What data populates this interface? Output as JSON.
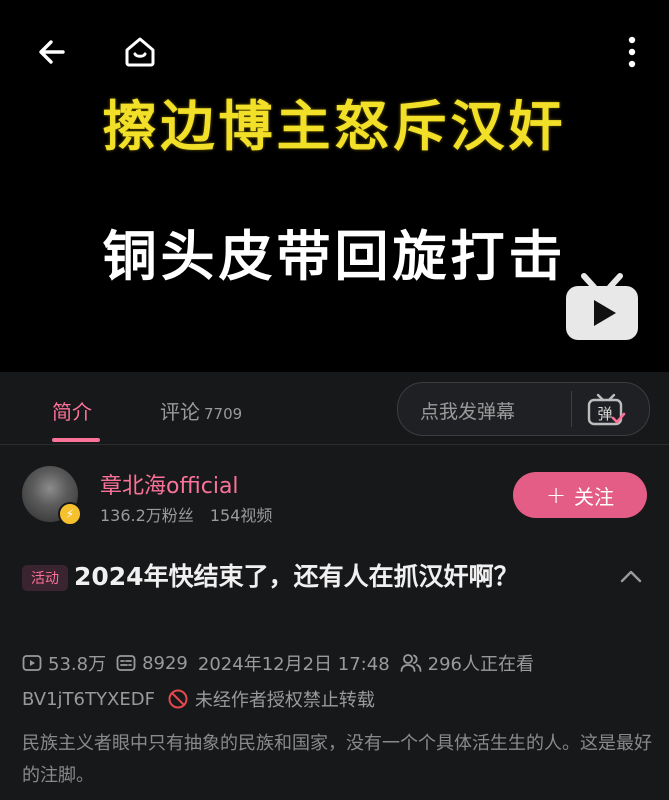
{
  "video": {
    "cover_line1": "擦边博主怒斥汉奸",
    "cover_line2": "铜头皮带回旋打击"
  },
  "tabs": {
    "intro_label": "简介",
    "comments_label": "评论",
    "comments_count": "7709"
  },
  "danmaku": {
    "placeholder": "点我发弹幕",
    "button_glyph": "弹"
  },
  "uploader": {
    "name": "章北海official",
    "fans": "136.2万粉丝",
    "videos": "154视频",
    "follow_label": "关注"
  },
  "video_info": {
    "activity_tag": "活动",
    "title": "2024年快结束了，还有人在抓汉奸啊？",
    "views": "53.8万",
    "danmaku_count": "8929",
    "publish_time": "2024年12月2日 17:48",
    "watching_now": "296人正在看",
    "bvid": "BV1jT6TYXEDF",
    "reprint_notice": "未经作者授权禁止转载",
    "description": "民族主义者眼中只有抽象的民族和国家，没有一个个具体活生生的人。这是最好的注脚。"
  },
  "colors": {
    "accent": "#fb7299",
    "follow_button": "#e35d86",
    "background": "#17181a",
    "cover_yellow": "#f2df28"
  }
}
